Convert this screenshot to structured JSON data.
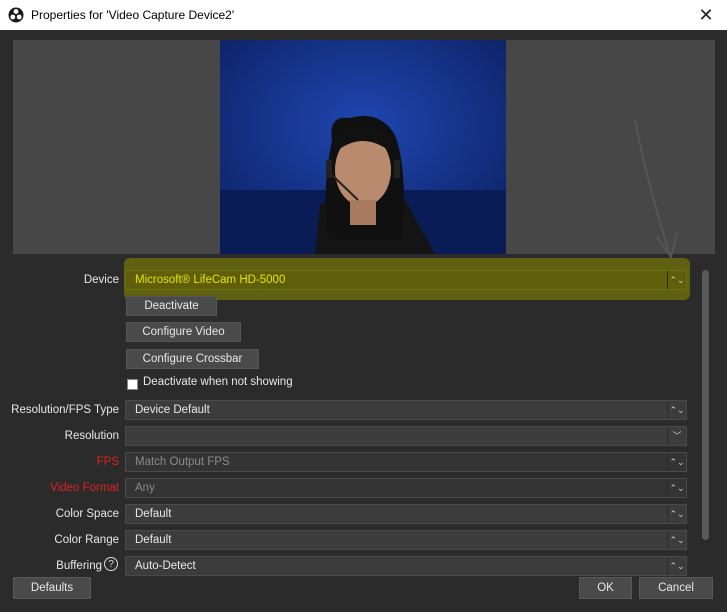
{
  "window": {
    "title": "Properties for 'Video Capture Device2'",
    "close_symbol": "✕"
  },
  "properties": {
    "device_label": "Device",
    "device_value": "Microsoft® LifeCam HD-5000",
    "deactivate_button": "Deactivate",
    "configure_video_button": "Configure Video",
    "configure_crossbar_button": "Configure Crossbar",
    "deactivate_when_not_showing_label": "Deactivate when not showing",
    "resolution_fps_type_label": "Resolution/FPS Type",
    "resolution_fps_type_value": "Device Default",
    "resolution_label": "Resolution",
    "resolution_value": "",
    "fps_label": "FPS",
    "fps_value": "Match Output FPS",
    "video_format_label": "Video Format",
    "video_format_value": "Any",
    "color_space_label": "Color Space",
    "color_space_value": "Default",
    "color_range_label": "Color Range",
    "color_range_value": "Default",
    "buffering_label": "Buffering",
    "buffering_value": "Auto-Detect",
    "help_symbol": "?"
  },
  "footer": {
    "defaults_button": "Defaults",
    "ok_button": "OK",
    "cancel_button": "Cancel"
  },
  "colors": {
    "highlight": "#8c8c00",
    "error_label": "#e02020",
    "dialog_bg": "#2b2b2b"
  },
  "icons": {
    "app": "obs-icon",
    "close": "close-icon",
    "combo_arrow": "up-down-chevron-icon",
    "dropdown_arrow": "chevron-down-icon",
    "help": "help-icon",
    "annotation": "hand-drawn-arrow-icon"
  }
}
